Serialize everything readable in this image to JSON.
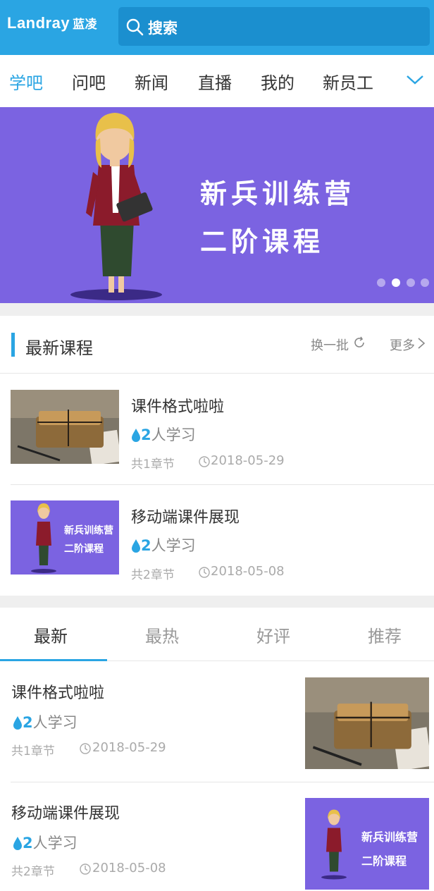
{
  "header": {
    "logo_text": "Landray",
    "logo_cn": "蓝凌",
    "search_text": "搜索",
    "search_icon": "search-icon"
  },
  "nav_tabs": [
    "学吧",
    "问吧",
    "新闻",
    "直播",
    "我的",
    "新员工"
  ],
  "nav_active": "学吧",
  "banner": {
    "line1": "新兵训练营",
    "line2": "二阶课程",
    "dots": 4,
    "active_dot": 2
  },
  "latest": {
    "title": "最新课程",
    "refresh": "换一批",
    "more": "更多"
  },
  "courses": [
    {
      "title": "课件格式啦啦",
      "learners_num": "2",
      "learners_suffix": "人学习",
      "chapters": "共1章节",
      "date": "2018-05-29",
      "thumb": "package-photo"
    },
    {
      "title": "移动端课件展现",
      "learners_num": "2",
      "learners_suffix": "人学习",
      "chapters": "共2章节",
      "date": "2018-05-08",
      "thumb": "bootcamp-banner",
      "thumb_line1": "新兵训练营",
      "thumb_line2": "二阶课程"
    }
  ],
  "list_tabs": [
    "最新",
    "最热",
    "好评",
    "推荐"
  ],
  "list_active": "最新",
  "colors": {
    "primary": "#2aa5e3",
    "banner": "#7b63e1",
    "header_search": "#1b8fcf"
  }
}
